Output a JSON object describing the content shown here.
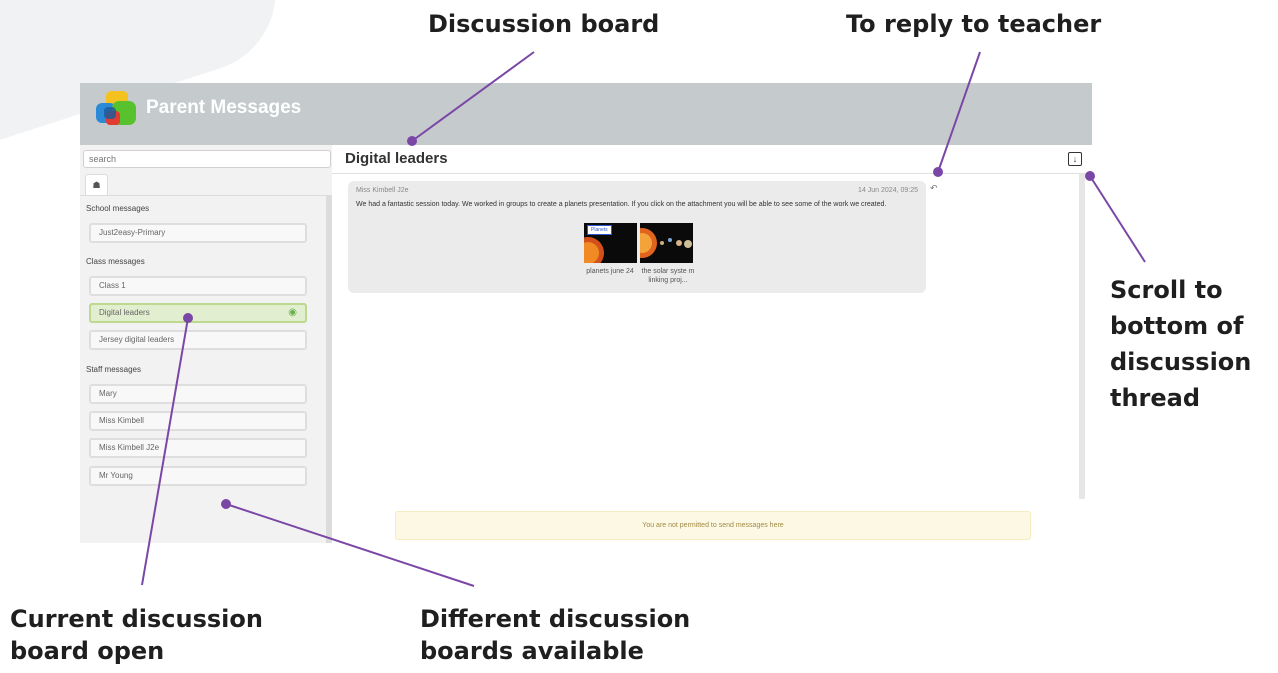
{
  "colors": {
    "header": "#c5cbcd",
    "active_item": "#e2eed0",
    "callout_line": "#7b47a6",
    "notice_bg": "#fcf8e3"
  },
  "callouts": {
    "discussion_board": "Discussion board",
    "reply_teacher": "To reply to teacher",
    "scroll_bottom": [
      "Scroll to",
      "bottom of",
      "discussion",
      "thread"
    ],
    "current_board": [
      "Current discussion",
      "board open"
    ],
    "different_boards": [
      "Different discussion",
      "boards available"
    ]
  },
  "app": {
    "title": "Parent Messages",
    "logo_icon": "speech-bubbles-logo"
  },
  "sidebar": {
    "search_placeholder": "search",
    "home_icon": "home-icon",
    "sections": [
      {
        "label": "School messages",
        "items": [
          {
            "label": "Just2easy-Primary"
          }
        ]
      },
      {
        "label": "Class messages",
        "items": [
          {
            "label": "Class 1"
          },
          {
            "label": "Digital leaders",
            "active": true,
            "icon": "eye-icon"
          },
          {
            "label": "Jersey digital leaders"
          }
        ]
      },
      {
        "label": "Staff messages",
        "items": [
          {
            "label": "Mary"
          },
          {
            "label": "Miss Kimbell"
          },
          {
            "label": "Miss Kimbell J2e"
          },
          {
            "label": "Mr Young"
          }
        ]
      }
    ]
  },
  "main": {
    "title": "Digital leaders",
    "scroll_icon": "scroll-to-bottom-icon",
    "message": {
      "author": "Miss Kimbell J2e",
      "time": "14 Jun 2024, 09:25",
      "text": "We had a fantastic session today. We worked in groups to create a planets presentation. If you click on the attachment you will be able to see some of the work we created.",
      "reply_icon": "reply-icon",
      "attachments": [
        {
          "thumb_label": "Planets",
          "caption": "planets june 24"
        },
        {
          "caption": "the solar syste m linking proj..."
        }
      ]
    },
    "notice": "You are not permitted to send messages here"
  }
}
